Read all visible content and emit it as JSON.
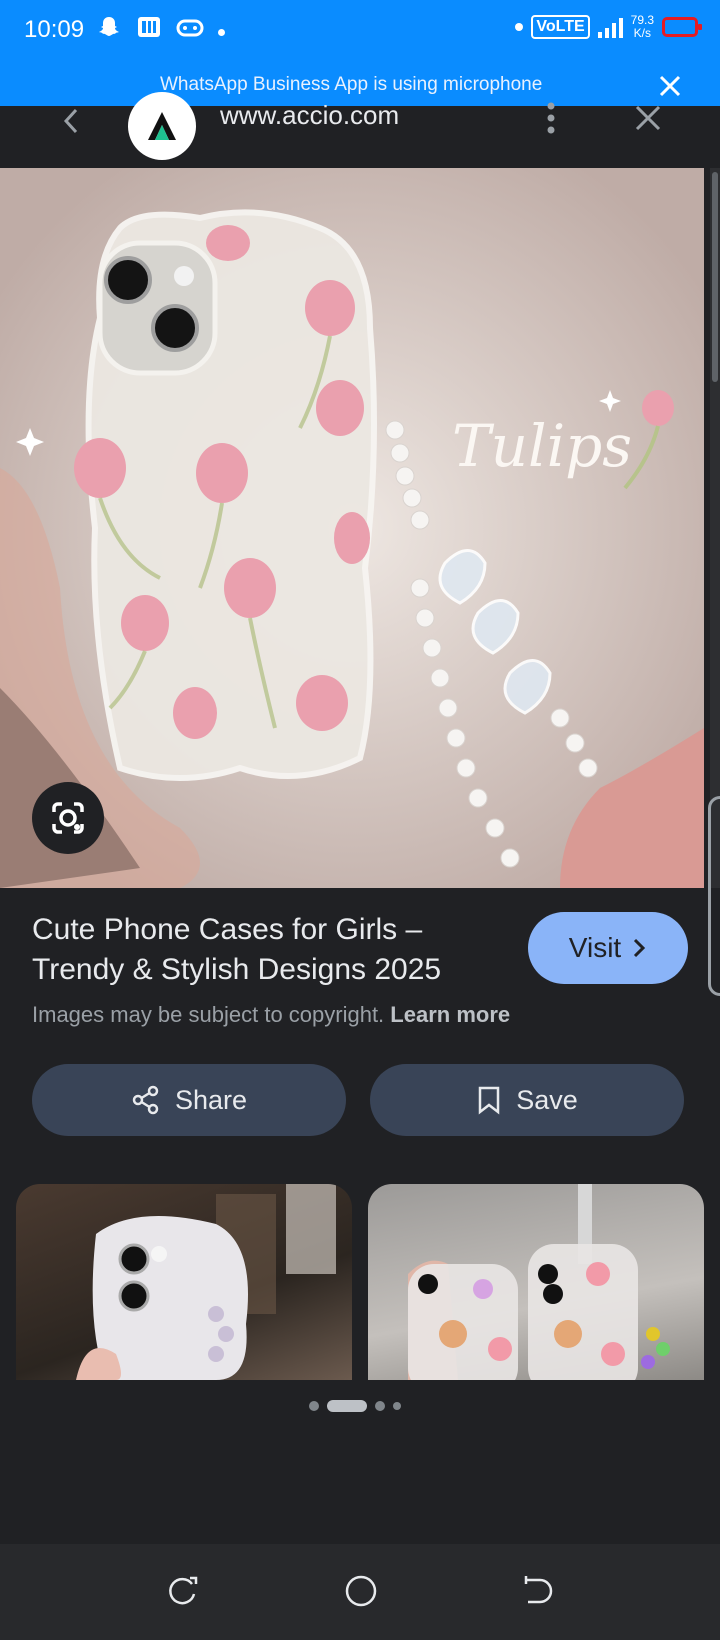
{
  "status_bar": {
    "time": "10:09",
    "network_label": "VoLTE",
    "speed_value": "79.3",
    "speed_unit": "K/s",
    "colors": {
      "background": "#0a8cff",
      "battery": "#e51c23"
    }
  },
  "mic_banner": {
    "text": "WhatsApp Business App is using microphone"
  },
  "browser": {
    "url": "www.accio.com"
  },
  "result": {
    "title": "Cute Phone Cases for Girls – Trendy & Stylish Designs 2025",
    "visit_label": "Visit",
    "copyright_text": "Images may be subject to copyright.",
    "learn_more": "Learn more",
    "share_label": "Share",
    "save_label": "Save"
  },
  "hero_image": {
    "overlay_text": "Tulips"
  },
  "pagination": {
    "count": 4,
    "active_index": 1
  },
  "colors": {
    "accent": "#8ab4f8",
    "surface": "#202124",
    "button": "#394457"
  }
}
